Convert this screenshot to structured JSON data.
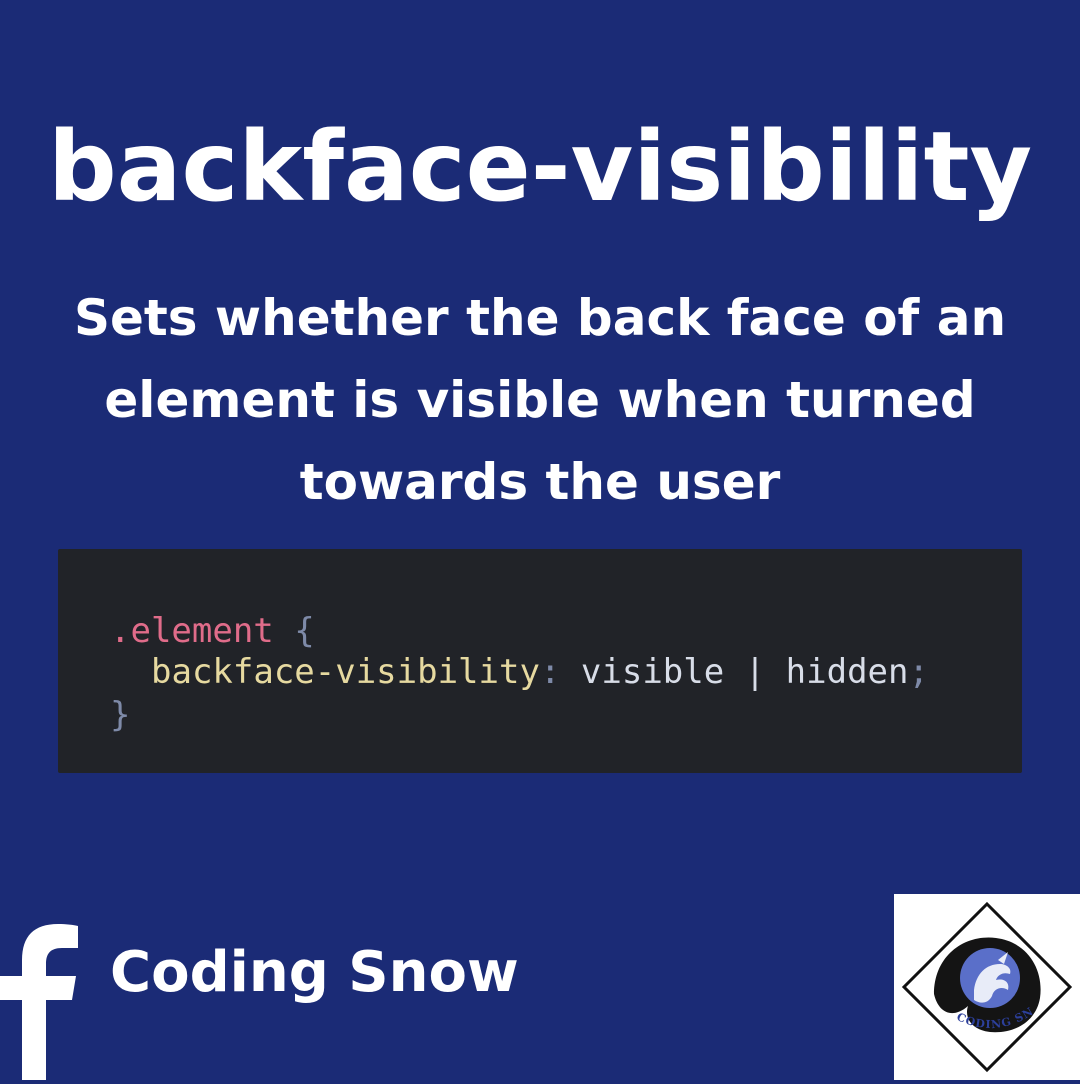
{
  "header": {
    "title": "backface-visibility",
    "subtitle": "Sets whether the back face of an element is visible when turned towards the user"
  },
  "code": {
    "selector": ".element",
    "open_brace": "{",
    "property": "backface-visibility",
    "colon": ":",
    "value_1": "visible",
    "separator": "|",
    "value_2": "hidden",
    "semicolon": ";",
    "close_brace": "}"
  },
  "footer": {
    "social_icon": "facebook-icon",
    "brand_name": "Coding Snow",
    "logo_text": "CODING SNOW"
  },
  "colors": {
    "background": "#1b2b76",
    "code_background": "#212328",
    "selector": "#e06c8a",
    "property": "#e6d9a0",
    "text": "#ffffff"
  }
}
